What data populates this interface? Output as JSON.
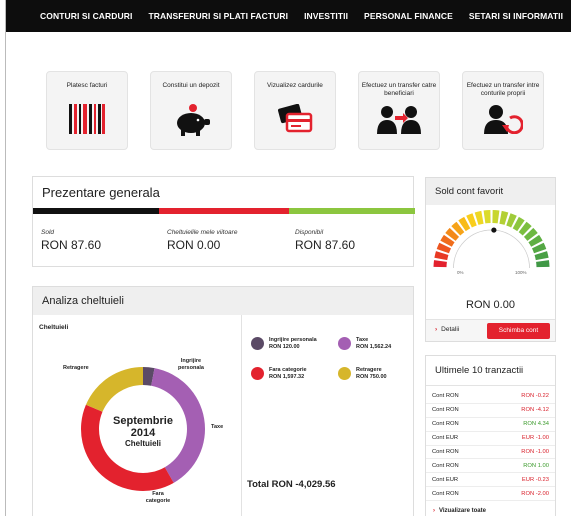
{
  "nav": {
    "items": [
      "CONTURI SI CARDURI",
      "TRANSFERURI SI PLATI FACTURI",
      "INVESTITII",
      "PERSONAL FINANCE",
      "SETARI SI INFORMATII"
    ]
  },
  "actions": [
    {
      "label": "Platesc facturi",
      "icon": "barcode-icon"
    },
    {
      "label": "Constitui un depozit",
      "icon": "piggy-bank-icon"
    },
    {
      "label": "Vizualizez cardurile",
      "icon": "cards-icon"
    },
    {
      "label": "Efectuez un transfer catre beneficiari",
      "icon": "transfer-people-icon"
    },
    {
      "label": "Efectuez un transfer intre conturile proprii",
      "icon": "own-transfer-icon"
    }
  ],
  "overview": {
    "title": "Prezentare generala",
    "bar": {
      "black_share": 0.33,
      "red_share": 0.34,
      "green_share": 0.33
    },
    "columns": [
      {
        "label": "Sold",
        "value": "RON  87.60"
      },
      {
        "label": "Cheltuielile mele viitoare",
        "value": "RON     0.00"
      },
      {
        "label": "Disponibil",
        "value": "RON  87.60"
      }
    ]
  },
  "favorite": {
    "title": "Sold cont favorit",
    "gauge_min": "0%",
    "gauge_max": "100%",
    "gauge_level": 0.52,
    "amount": "RON 0.00",
    "details_label": "Detalii",
    "change_label": "Schimba cont"
  },
  "analysis": {
    "title": "Analiza cheltuieli",
    "subtitle": "Cheltuieli",
    "center": {
      "month": "Septembrie",
      "year": "2014",
      "caption": "Cheltuieli"
    },
    "donut_labels": {
      "retragere": "Retragere",
      "ingrijire": "Ingrijire personala",
      "taxe": "Taxe",
      "fara": "Fara categorie"
    },
    "legend": [
      {
        "name": "Ingrijire personala",
        "amount": "RON 120.00",
        "color": "#5b4a66"
      },
      {
        "name": "Taxe",
        "amount": "RON 1,562.24",
        "color": "#a45fb3"
      },
      {
        "name": "Fara categorie",
        "amount": "RON 1,597.32",
        "color": "#e3222e"
      },
      {
        "name": "Retragere",
        "amount": "RON 750.00",
        "color": "#d6b62b"
      }
    ],
    "total": "Total RON  -4,029.56"
  },
  "transactions": {
    "title": "Ultimele 10 tranzactii",
    "rows": [
      {
        "account": "Cont RON",
        "amount": "RON -0.22",
        "sign": "neg"
      },
      {
        "account": "Cont RON",
        "amount": "RON -4.12",
        "sign": "neg"
      },
      {
        "account": "Cont RON",
        "amount": "RON 4.34",
        "sign": "pos"
      },
      {
        "account": "Cont EUR",
        "amount": "EUR -1.00",
        "sign": "neg"
      },
      {
        "account": "Cont RON",
        "amount": "RON -1.00",
        "sign": "neg"
      },
      {
        "account": "Cont RON",
        "amount": "RON 1.00",
        "sign": "pos"
      },
      {
        "account": "Cont EUR",
        "amount": "EUR -0.23",
        "sign": "neg"
      },
      {
        "account": "Cont RON",
        "amount": "RON -2.00",
        "sign": "neg"
      }
    ],
    "view_all": "Vizualizare toate"
  }
}
